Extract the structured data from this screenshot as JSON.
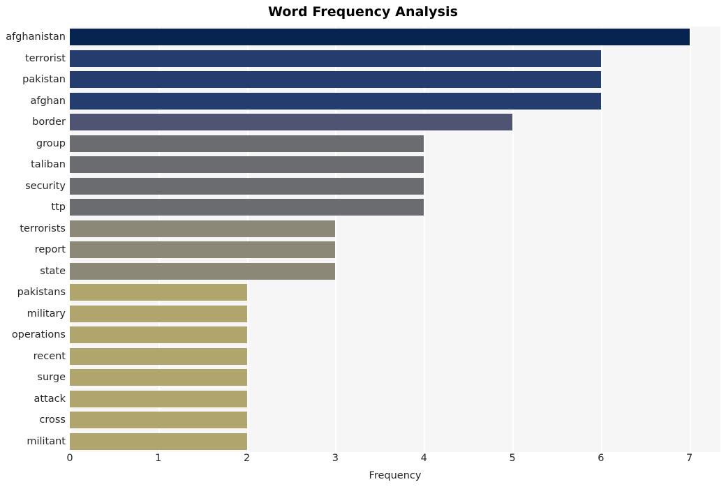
{
  "chart_data": {
    "type": "bar",
    "orientation": "horizontal",
    "title": "Word Frequency Analysis",
    "xlabel": "Frequency",
    "ylabel": "",
    "xlim": [
      0,
      7.35
    ],
    "ylim": [
      0,
      20
    ],
    "xticks": [
      "0",
      "1",
      "2",
      "3",
      "4",
      "5",
      "6",
      "7"
    ],
    "xtick_values": [
      0,
      1,
      2,
      3,
      4,
      5,
      6,
      7
    ],
    "grid": "vertical-only",
    "legend": "none",
    "categories": [
      "afghanistan",
      "terrorist",
      "pakistan",
      "afghan",
      "border",
      "group",
      "taliban",
      "security",
      "ttp",
      "terrorists",
      "report",
      "state",
      "pakistans",
      "military",
      "operations",
      "recent",
      "surge",
      "attack",
      "cross",
      "militant"
    ],
    "values": [
      7,
      6,
      6,
      6,
      5,
      4,
      4,
      4,
      4,
      3,
      3,
      3,
      2,
      2,
      2,
      2,
      2,
      2,
      2,
      2
    ],
    "bar_colors": [
      "#06244f",
      "#243c6e",
      "#243c6e",
      "#243c6e",
      "#4e5472",
      "#6b6c70",
      "#6b6c70",
      "#6b6c70",
      "#6b6c70",
      "#8c8878",
      "#8c8878",
      "#8c8878",
      "#b0a66d",
      "#b0a66d",
      "#b0a66d",
      "#b0a66d",
      "#b0a66d",
      "#b0a66d",
      "#b0a66d",
      "#b0a66d"
    ],
    "plot_background": "#f6f6f7",
    "grid_color": "#ffffff",
    "figure_background": "#ffffff",
    "text_color": "#262626",
    "title_color": "#000000"
  }
}
